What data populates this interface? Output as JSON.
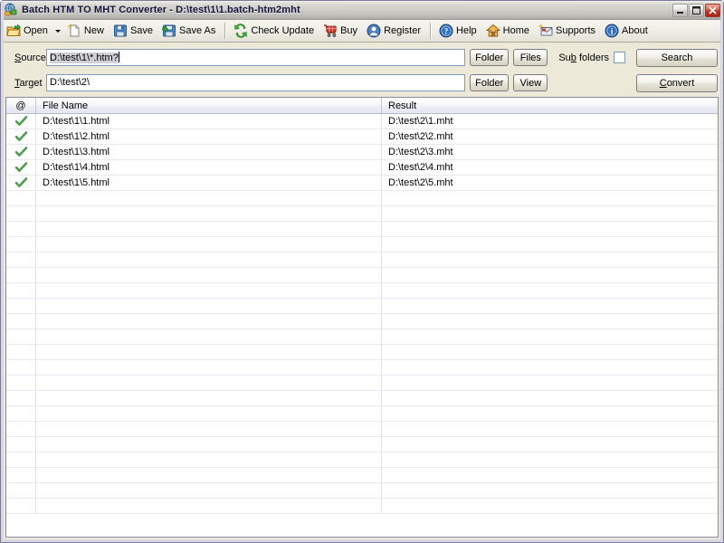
{
  "window": {
    "title": "Batch HTM TO MHT Converter - D:\\test\\1\\1.batch-htm2mht",
    "icon": "app-globe-icon",
    "controls": {
      "minimize": "–",
      "maximize": "❑",
      "close": "✕"
    }
  },
  "toolbar": {
    "items": [
      {
        "label": "Open",
        "icon": "open-folder-icon",
        "dropdown": true
      },
      {
        "label": "New",
        "icon": "new-document-icon",
        "dropdown": false
      },
      {
        "label": "Save",
        "icon": "save-floppy-icon",
        "dropdown": false
      },
      {
        "label": "Save As",
        "icon": "save-as-floppy-icon",
        "dropdown": false
      },
      {
        "label": "Check Update",
        "icon": "refresh-arrows-icon",
        "dropdown": false
      },
      {
        "label": "Buy",
        "icon": "shopping-cart-icon",
        "dropdown": false
      },
      {
        "label": "Register",
        "icon": "register-user-icon",
        "dropdown": false
      },
      {
        "label": "Help",
        "icon": "help-question-icon",
        "dropdown": false
      },
      {
        "label": "Home",
        "icon": "home-house-icon",
        "dropdown": false
      },
      {
        "label": "Supports",
        "icon": "mail-envelope-icon",
        "dropdown": false
      },
      {
        "label": "About",
        "icon": "info-circle-icon",
        "dropdown": false
      }
    ]
  },
  "paths": {
    "source": {
      "label": "Source",
      "value": "D:\\test\\1\\*.htm?",
      "placeholder": "",
      "folder_button": "Folder",
      "files_button": "Files"
    },
    "target": {
      "label": "Target",
      "value": "D:\\test\\2\\",
      "placeholder": "",
      "folder_button": "Folder",
      "view_button": "View"
    },
    "subfolders": {
      "label": "Sub folders",
      "checked": false
    },
    "search_button": "Search",
    "convert_button": "Convert"
  },
  "list": {
    "columns": [
      "@",
      "File Name",
      "Result"
    ],
    "rows": [
      {
        "status": "done",
        "file": "D:\\test\\1\\1.html",
        "result": "D:\\test\\2\\1.mht"
      },
      {
        "status": "done",
        "file": "D:\\test\\1\\2.html",
        "result": "D:\\test\\2\\2.mht"
      },
      {
        "status": "done",
        "file": "D:\\test\\1\\3.html",
        "result": "D:\\test\\2\\3.mht"
      },
      {
        "status": "done",
        "file": "D:\\test\\1\\4.html",
        "result": "D:\\test\\2\\4.mht"
      },
      {
        "status": "done",
        "file": "D:\\test\\1\\5.html",
        "result": "D:\\test\\2\\5.mht"
      }
    ],
    "empty_row_count": 21
  },
  "colors": {
    "accent": "#2b6ab5",
    "success": "#2d8a2d",
    "window_face": "#ece9d8",
    "title_text": "#14143c"
  }
}
